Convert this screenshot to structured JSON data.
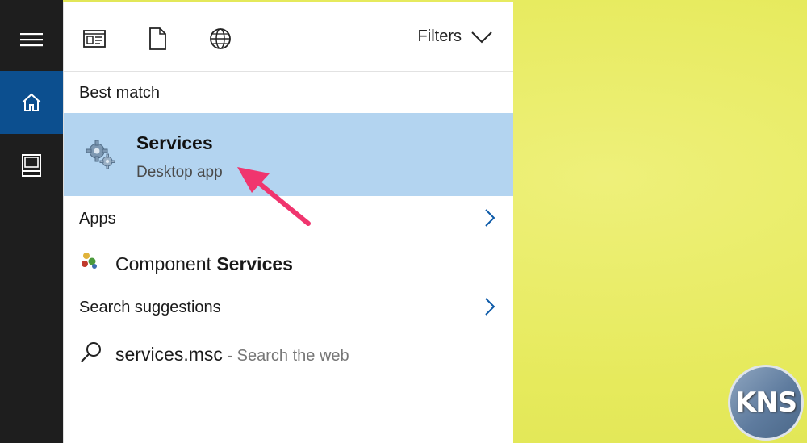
{
  "rail": {
    "items": [
      {
        "icon": "hamburger-menu-icon"
      },
      {
        "icon": "home-icon"
      },
      {
        "icon": "notebook-icon"
      }
    ]
  },
  "topbar": {
    "icons": [
      "apps-view-icon",
      "documents-icon",
      "web-icon"
    ],
    "filters_label": "Filters"
  },
  "best_match": {
    "heading": "Best match",
    "title": "Services",
    "subtitle": "Desktop app"
  },
  "apps": {
    "heading": "Apps",
    "item_prefix": "Component ",
    "item_bold": "Services"
  },
  "suggestions": {
    "heading": "Search suggestions",
    "query": "services.msc",
    "hint": " - Search the web"
  },
  "watermark": {
    "text": "KNS"
  },
  "colors": {
    "rail_bg": "#1e1e1e",
    "rail_active": "#0c4f8f",
    "selection": "#b3d4f0",
    "accent_chevron": "#0c5aa8",
    "arrow": "#f0356e",
    "desktop": "#e6ea5c"
  }
}
